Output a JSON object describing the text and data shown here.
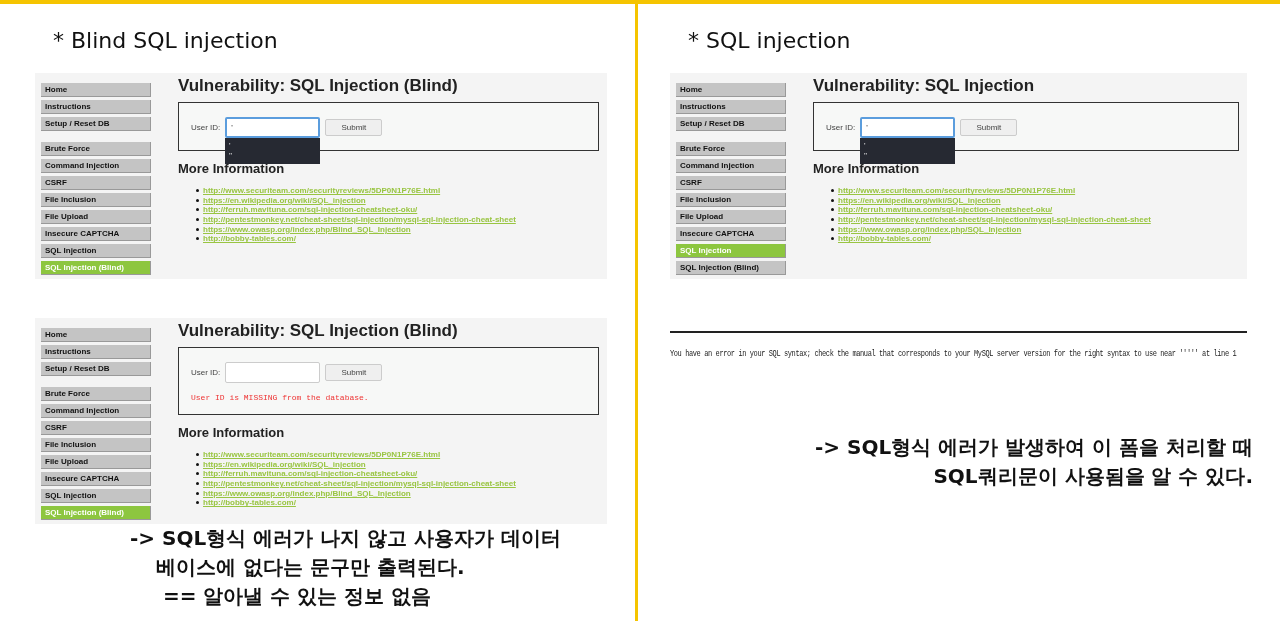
{
  "sections": [
    {
      "heading": "* Blind SQL injection",
      "screenshots": [
        {
          "menu_groups": [
            {
              "items": [
                {
                  "label": "Home",
                  "selected": false
                },
                {
                  "label": "Instructions",
                  "selected": false
                },
                {
                  "label": "Setup / Reset DB",
                  "selected": false
                }
              ]
            },
            {
              "items": [
                {
                  "label": "Brute Force",
                  "selected": false
                },
                {
                  "label": "Command Injection",
                  "selected": false
                },
                {
                  "label": "CSRF",
                  "selected": false
                },
                {
                  "label": "File Inclusion",
                  "selected": false
                },
                {
                  "label": "File Upload",
                  "selected": false
                },
                {
                  "label": "Insecure CAPTCHA",
                  "selected": false
                },
                {
                  "label": "SQL Injection",
                  "selected": false
                },
                {
                  "label": "SQL Injection (Blind)",
                  "selected": true
                }
              ]
            }
          ],
          "title": "Vulnerability: SQL Injection (Blind)",
          "field_label": "User ID:",
          "value": "'",
          "focused": true,
          "suggestions": [
            "'",
            "''"
          ],
          "submit": "Submit",
          "more_heading": "More Information",
          "links": [
            "http://www.securiteam.com/securityreviews/5DP0N1P76E.html",
            "https://en.wikipedia.org/wiki/SQL_injection",
            "http://ferruh.mavituna.com/sql-injection-cheatsheet-oku/",
            "http://pentestmonkey.net/cheat-sheet/sql-injection/mysql-sql-injection-cheat-sheet",
            "https://www.owasp.org/index.php/Blind_SQL_Injection",
            "http://bobby-tables.com/"
          ]
        },
        {
          "menu_groups": [
            {
              "items": [
                {
                  "label": "Home",
                  "selected": false
                },
                {
                  "label": "Instructions",
                  "selected": false
                },
                {
                  "label": "Setup / Reset DB",
                  "selected": false
                }
              ]
            },
            {
              "items": [
                {
                  "label": "Brute Force",
                  "selected": false
                },
                {
                  "label": "Command Injection",
                  "selected": false
                },
                {
                  "label": "CSRF",
                  "selected": false
                },
                {
                  "label": "File Inclusion",
                  "selected": false
                },
                {
                  "label": "File Upload",
                  "selected": false
                },
                {
                  "label": "Insecure CAPTCHA",
                  "selected": false
                },
                {
                  "label": "SQL Injection",
                  "selected": false
                },
                {
                  "label": "SQL Injection (Blind)",
                  "selected": true
                }
              ]
            }
          ],
          "title": "Vulnerability: SQL Injection (Blind)",
          "field_label": "User ID:",
          "focused": false,
          "submit": "Submit",
          "message": "User ID is MISSING from the database.",
          "more_heading": "More Information",
          "links": [
            "http://www.securiteam.com/securityreviews/5DP0N1P76E.html",
            "https://en.wikipedia.org/wiki/SQL_injection",
            "http://ferruh.mavituna.com/sql-injection-cheatsheet-oku/",
            "http://pentestmonkey.net/cheat-sheet/sql-injection/mysql-sql-injection-cheat-sheet",
            "https://www.owasp.org/index.php/Blind_SQL_Injection",
            "http://bobby-tables.com/"
          ]
        }
      ],
      "note": [
        "-> SQL형식 에러가 나지 않고 사용자가 데이터",
        "베이스에 없다는 문구만 출력된다.",
        "== 알아낼 수 있는 정보 없음"
      ]
    },
    {
      "heading": "* SQL injection",
      "screenshots": [
        {
          "menu_groups": [
            {
              "items": [
                {
                  "label": "Home",
                  "selected": false
                },
                {
                  "label": "Instructions",
                  "selected": false
                },
                {
                  "label": "Setup / Reset DB",
                  "selected": false
                }
              ]
            },
            {
              "items": [
                {
                  "label": "Brute Force",
                  "selected": false
                },
                {
                  "label": "Command Injection",
                  "selected": false
                },
                {
                  "label": "CSRF",
                  "selected": false
                },
                {
                  "label": "File Inclusion",
                  "selected": false
                },
                {
                  "label": "File Upload",
                  "selected": false
                },
                {
                  "label": "Insecure CAPTCHA",
                  "selected": false
                },
                {
                  "label": "SQL Injection",
                  "selected": true
                },
                {
                  "label": "SQL Injection (Blind)",
                  "selected": false
                }
              ]
            }
          ],
          "title": "Vulnerability: SQL Injection",
          "field_label": "User ID:",
          "value": "'",
          "focused": true,
          "suggestions": [
            "'",
            "''"
          ],
          "submit": "Submit",
          "more_heading": "More Information",
          "links": [
            "http://www.securiteam.com/securityreviews/5DP0N1P76E.html",
            "https://en.wikipedia.org/wiki/SQL_injection",
            "http://ferruh.mavituna.com/sql-injection-cheatsheet-oku/",
            "http://pentestmonkey.net/cheat-sheet/sql-injection/mysql-sql-injection-cheat-sheet",
            "https://www.owasp.org/index.php/SQL_Injection",
            "http://bobby-tables.com/"
          ]
        }
      ],
      "error_text": "You have an error in your SQL syntax; check the manual that corresponds to your MySQL server version for the right syntax to use near ''''' at line 1",
      "note": [
        "-> SQL형식 에러가 발생하여 이 폼을 처리할 때",
        "SQL쿼리문이 사용됨을 알 수 있다."
      ]
    }
  ]
}
